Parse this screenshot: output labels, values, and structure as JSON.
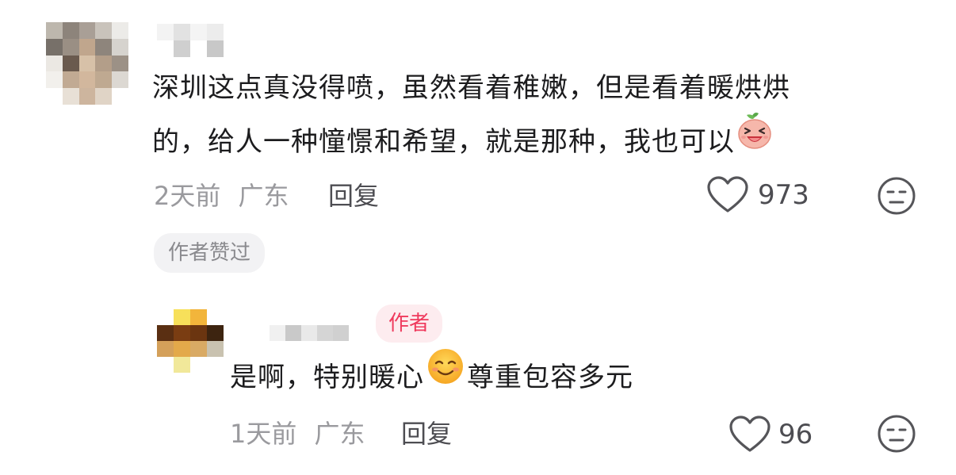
{
  "comment": {
    "text_line1": "深圳这点真没得喷，虽然看着稚嫩，但是看着暖烘烘",
    "text_line2": "的，给人一种憧憬和希望，就是那种，我也可以",
    "emoji_icon": "laughing-peach-icon",
    "time": "2天前",
    "location": "广东",
    "reply_label": "回复",
    "like_count": "973",
    "liked_by_author_label": "作者赞过"
  },
  "reply": {
    "author_badge": "作者",
    "text_before_emoji": "是啊，特别暖心",
    "emoji_icon": "smiling-face-icon",
    "text_after_emoji": "尊重包容多元",
    "time": "1天前",
    "location": "广东",
    "reply_label": "回复",
    "like_count": "96"
  },
  "colors": {
    "text": "#1c1c1e",
    "meta": "#9a9a9e",
    "accent_badge": "#ef3a5d",
    "pill_bg": "#f2f2f4"
  }
}
